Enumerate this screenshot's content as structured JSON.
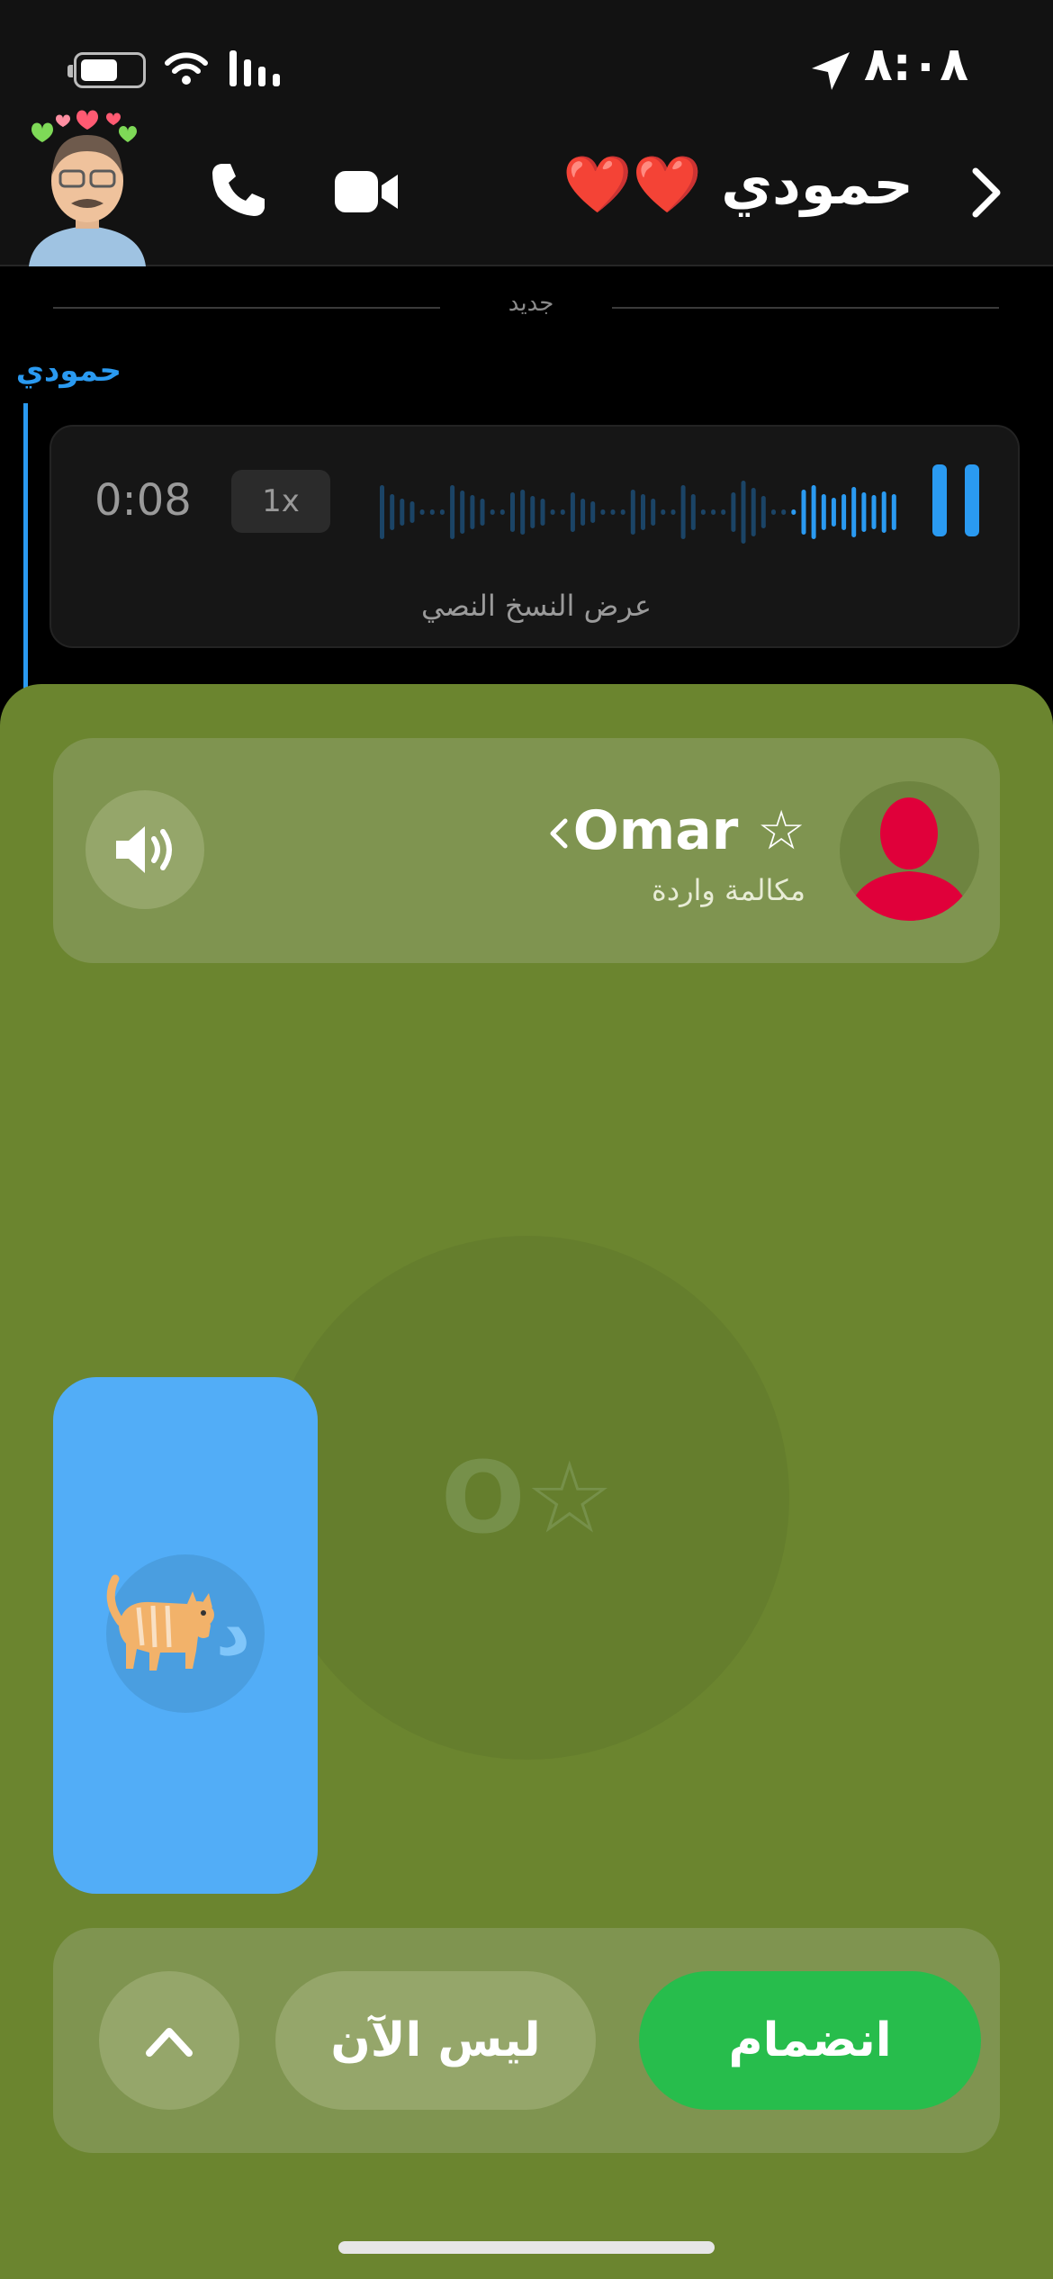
{
  "status_bar": {
    "time": "٨:٠٨",
    "icons": [
      "battery-icon",
      "wifi-icon",
      "signal-icon",
      "location-arrow-icon"
    ]
  },
  "header": {
    "contact_name": "حمودي ❤️❤️",
    "icons": [
      "bitmoji-avatar",
      "phone-icon",
      "video-camera-icon",
      "chevron-right-icon"
    ]
  },
  "chat": {
    "divider_label": "جديد",
    "sender_name": "حمودي",
    "accent_color": "#2a9af1",
    "voice_note": {
      "duration": "0:08",
      "speed_label": "1x",
      "transcript_label": "عرض النسخ النصي",
      "state_icon": "pause-icon"
    }
  },
  "call": {
    "background_color": "#6b852f",
    "caller_name": "Omar ☆",
    "caller_status": "مكالمة واردة",
    "caller_initials": "O☆",
    "self_initial": "د",
    "self_emoji": "🐈",
    "self_tile_color": "#52adf7",
    "buttons": {
      "join_label": "انضمام",
      "decline_label": "ليس الآن",
      "join_color": "#27bd4c"
    },
    "icons": [
      "speaker-icon",
      "person-silhouette-icon",
      "chevron-left-icon",
      "chevron-up-icon"
    ]
  }
}
